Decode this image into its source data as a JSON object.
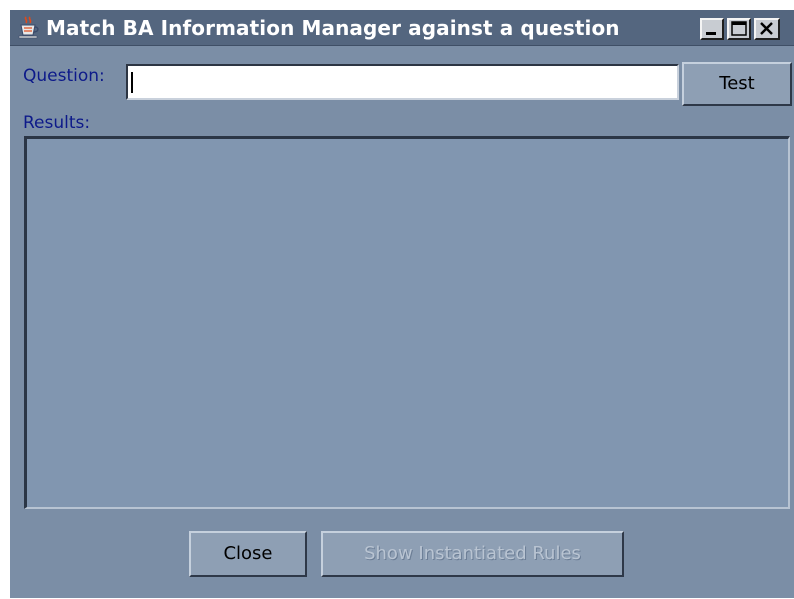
{
  "window": {
    "title": "Match BA Information Manager against a question",
    "icon": "java-coffee-cup-icon",
    "controls": [
      "minimize-icon",
      "maximize-icon",
      "close-icon"
    ]
  },
  "form": {
    "question_label": "Question:",
    "question_value": "",
    "test_label": "Test",
    "results_label": "Results:",
    "results_text": ""
  },
  "footer": {
    "close_label": "Close",
    "show_rules_label": "Show Instantiated Rules",
    "show_rules_enabled": false
  },
  "colors": {
    "titlebar": "#54667f",
    "window_bg": "#7b8ea6",
    "label_text": "#0d1a8a",
    "results_bg": "#8196b0"
  }
}
